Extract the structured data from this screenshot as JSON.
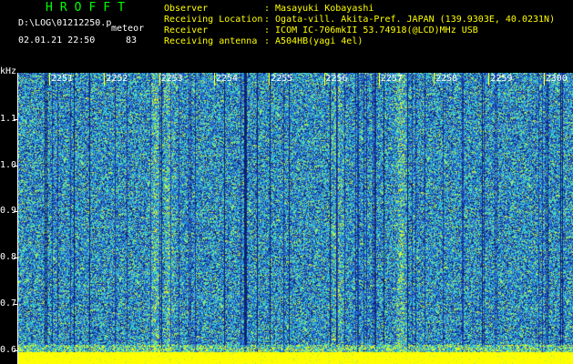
{
  "header": {
    "app_title": "HROFFT",
    "file_path": "D:\\LOG\\01212250.p",
    "mode": "meteor",
    "datetime": "02.01.21 22:50",
    "count": "83"
  },
  "info": [
    {
      "label": "Observer",
      "value": ": Masayuki Kobayashi"
    },
    {
      "label": "Receiving Location",
      "value": ": Ogata-vill. Akita-Pref. JAPAN (139.9303E, 40.0231N)"
    },
    {
      "label": "Receiver",
      "value": ": ICOM IC-706mkII 53.74918(@LCD)MHz USB"
    },
    {
      "label": "Receiving antenna",
      "value": ": A504HB(yagi 4el)"
    }
  ],
  "chart_data": {
    "type": "heatmap",
    "ylabel": "kHz",
    "x_ticks": [
      "2251",
      "2252",
      "2253",
      "2254",
      "2255",
      "2256",
      "2257",
      "2258",
      "2259",
      "2300"
    ],
    "y_ticks": [
      "1.1",
      "1.0",
      "0.9",
      "0.8",
      "0.7",
      "0.6"
    ],
    "y_values": [
      1.1,
      1.0,
      0.9,
      0.8,
      0.7,
      0.6
    ],
    "ylim": [
      0.57,
      1.2
    ],
    "colormap": [
      "#0a1f6e",
      "#1e3fb0",
      "#2a6fd8",
      "#30b0e0",
      "#40e0c0",
      "#c0f040",
      "#ffff00"
    ]
  }
}
